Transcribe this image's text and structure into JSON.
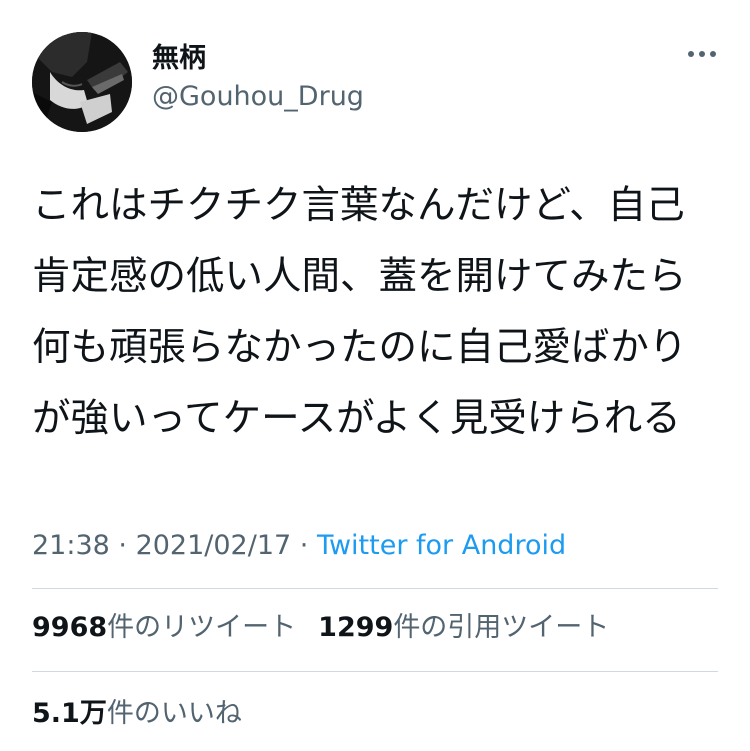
{
  "author": {
    "display_name": "無柄",
    "handle": "@Gouhou_Drug",
    "avatar_icon": "profile-avatar"
  },
  "more_icon": "more-horizontal-icon",
  "tweet": {
    "text": "これはチクチク言葉なんだけど、自己肯定感の低い人間、蓋を開けてみたら何も頑張らなかったのに自己愛ばかりが強いってケースがよく見受けられる"
  },
  "meta": {
    "time": "21:38",
    "separator": " · ",
    "date": "2021/02/17",
    "source": "Twitter for Android"
  },
  "stats": {
    "retweets_count": "9968",
    "retweets_label": "件のリツイート",
    "quotes_count": "1299",
    "quotes_label": "件の引用ツイート",
    "likes_count": "5.1万",
    "likes_label": "件のいいね"
  },
  "colors": {
    "text": "#0f1419",
    "secondary": "#536471",
    "link": "#1d9bf0",
    "divider": "#cfd9de"
  }
}
